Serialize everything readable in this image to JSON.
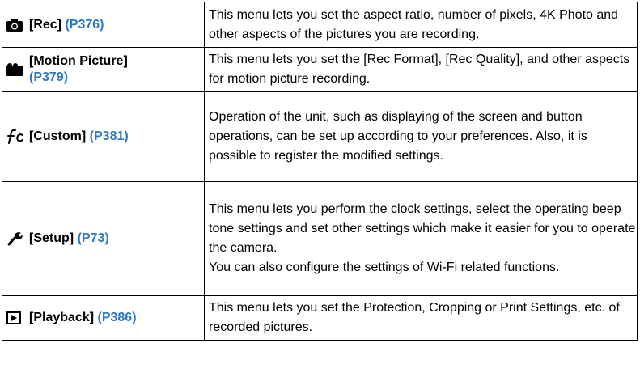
{
  "menu_rows": [
    {
      "icon": "camera-icon",
      "label": "[Rec]",
      "page_ref": "(P376)",
      "description": "This menu lets you set the aspect ratio, number of pixels, 4K Photo and other aspects of the pictures you are recording."
    },
    {
      "icon": "movie-camera-icon",
      "label": "[Motion Picture]",
      "page_ref": "(P379)",
      "description": "This menu lets you set the [Rec Format], [Rec Quality], and other aspects for motion picture recording."
    },
    {
      "icon": "custom-icon",
      "label": "[Custom]",
      "page_ref": "(P381)",
      "description": "Operation of the unit, such as displaying of the screen and button operations, can be set up according to your preferences. Also, it is possible to register the modified settings."
    },
    {
      "icon": "wrench-icon",
      "label": "[Setup]",
      "page_ref": "(P73)",
      "description_lines": [
        "This menu lets you perform the clock settings, select the operating beep tone settings and set other settings which make it easier for you to operate the camera.",
        "You can also configure the settings of Wi-Fi related functions."
      ]
    },
    {
      "icon": "playback-icon",
      "label": "[Playback]",
      "page_ref": "(P386)",
      "description": "This menu lets you set the Protection, Cropping or Print Settings, etc. of recorded pictures."
    }
  ],
  "colors": {
    "page_ref": "#2d79c4",
    "border": "#000000",
    "text": "#000000"
  }
}
